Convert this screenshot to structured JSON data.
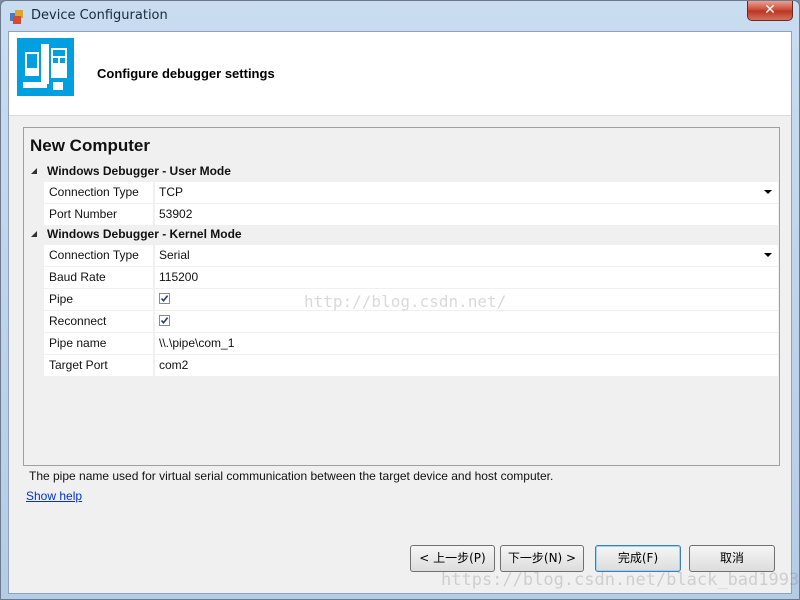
{
  "window": {
    "title": "Device Configuration",
    "close_label": "✕"
  },
  "header": {
    "title": "Configure debugger settings"
  },
  "grid": {
    "title": "New Computer",
    "categories": [
      {
        "label": "Windows Debugger - User Mode",
        "rows": [
          {
            "name": "Connection Type",
            "value": "TCP"
          },
          {
            "name": "Port Number",
            "value": "53902"
          }
        ]
      },
      {
        "label": "Windows Debugger - Kernel Mode",
        "rows": [
          {
            "name": "Connection Type",
            "value": "Serial"
          },
          {
            "name": "Baud Rate",
            "value": "115200"
          },
          {
            "name": "Pipe",
            "checked": true
          },
          {
            "name": "Reconnect",
            "checked": true
          },
          {
            "name": "Pipe name",
            "value": "\\\\.\\pipe\\com_1"
          },
          {
            "name": "Target Port",
            "value": "com2"
          }
        ]
      }
    ]
  },
  "description": "The pipe name used for virtual serial communication between the target device and host computer.",
  "show_help": "Show help",
  "buttons": {
    "back": "< 上一步(P)",
    "next": "下一步(N) >",
    "finish": "完成(F)",
    "cancel": "取消"
  },
  "watermarks": {
    "center": "http://blog.csdn.net/",
    "bottom": "https://blog.csdn.net/black_bad1993"
  },
  "colors": {
    "accent": "#00a0e0",
    "link": "#0033cc"
  }
}
